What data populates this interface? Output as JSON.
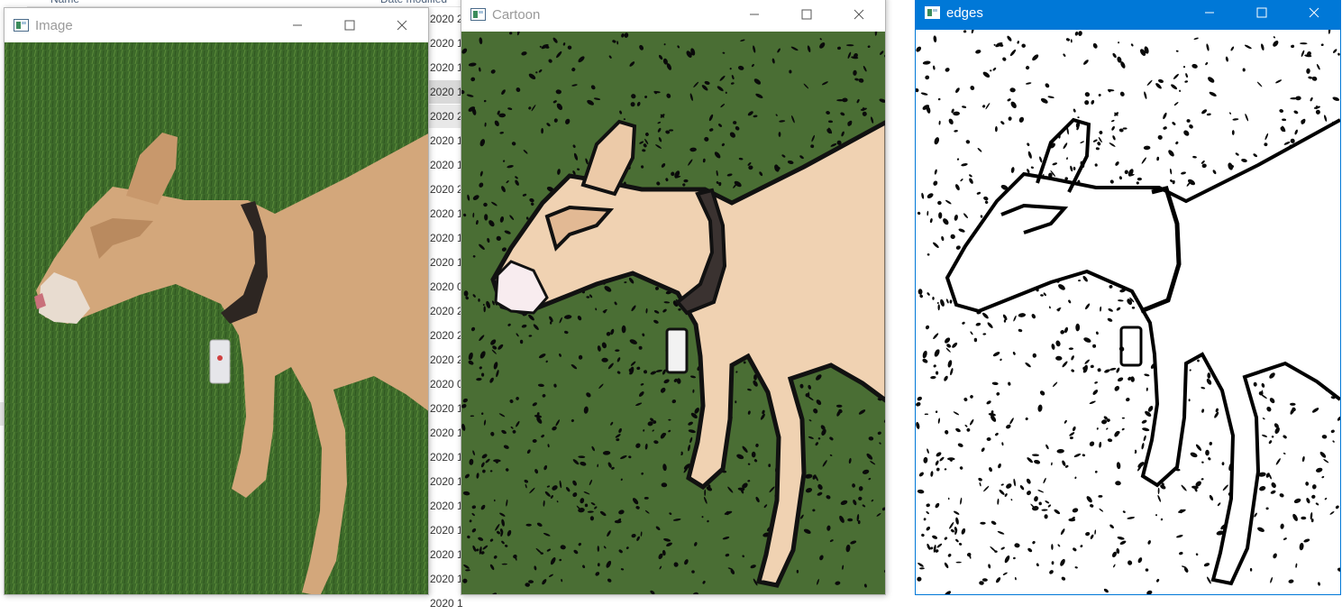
{
  "explorer": {
    "columns": {
      "name": "Name",
      "date_modified": "Date modified"
    },
    "date_cells": [
      "2020 2",
      "2020 1",
      "2020 1",
      "2020 1",
      "2020 2",
      "2020 1",
      "2020 1",
      "2020 2",
      "2020 1",
      "2020 1",
      "2020 1",
      "2020 0",
      "2020 2",
      "2020 2",
      "2020 2",
      "2020 0",
      "2020 1",
      "2020 1",
      "2020 1",
      "2020 1",
      "2020 1",
      "2020 1",
      "2020 1",
      "2020 1",
      "2020 1"
    ]
  },
  "windows": {
    "image": {
      "title": "Image"
    },
    "cartoon": {
      "title": "Cartoon"
    },
    "edges": {
      "title": "edges"
    }
  },
  "colors": {
    "grass": "#3f6b2b",
    "dog_fur": "#d2a67a",
    "collar": "#2b2420",
    "active_titlebar": "#0078d7"
  },
  "icons": {
    "minimize": "minimize-icon",
    "maximize": "maximize-icon",
    "close": "close-icon",
    "app": "opencv-window-icon"
  }
}
